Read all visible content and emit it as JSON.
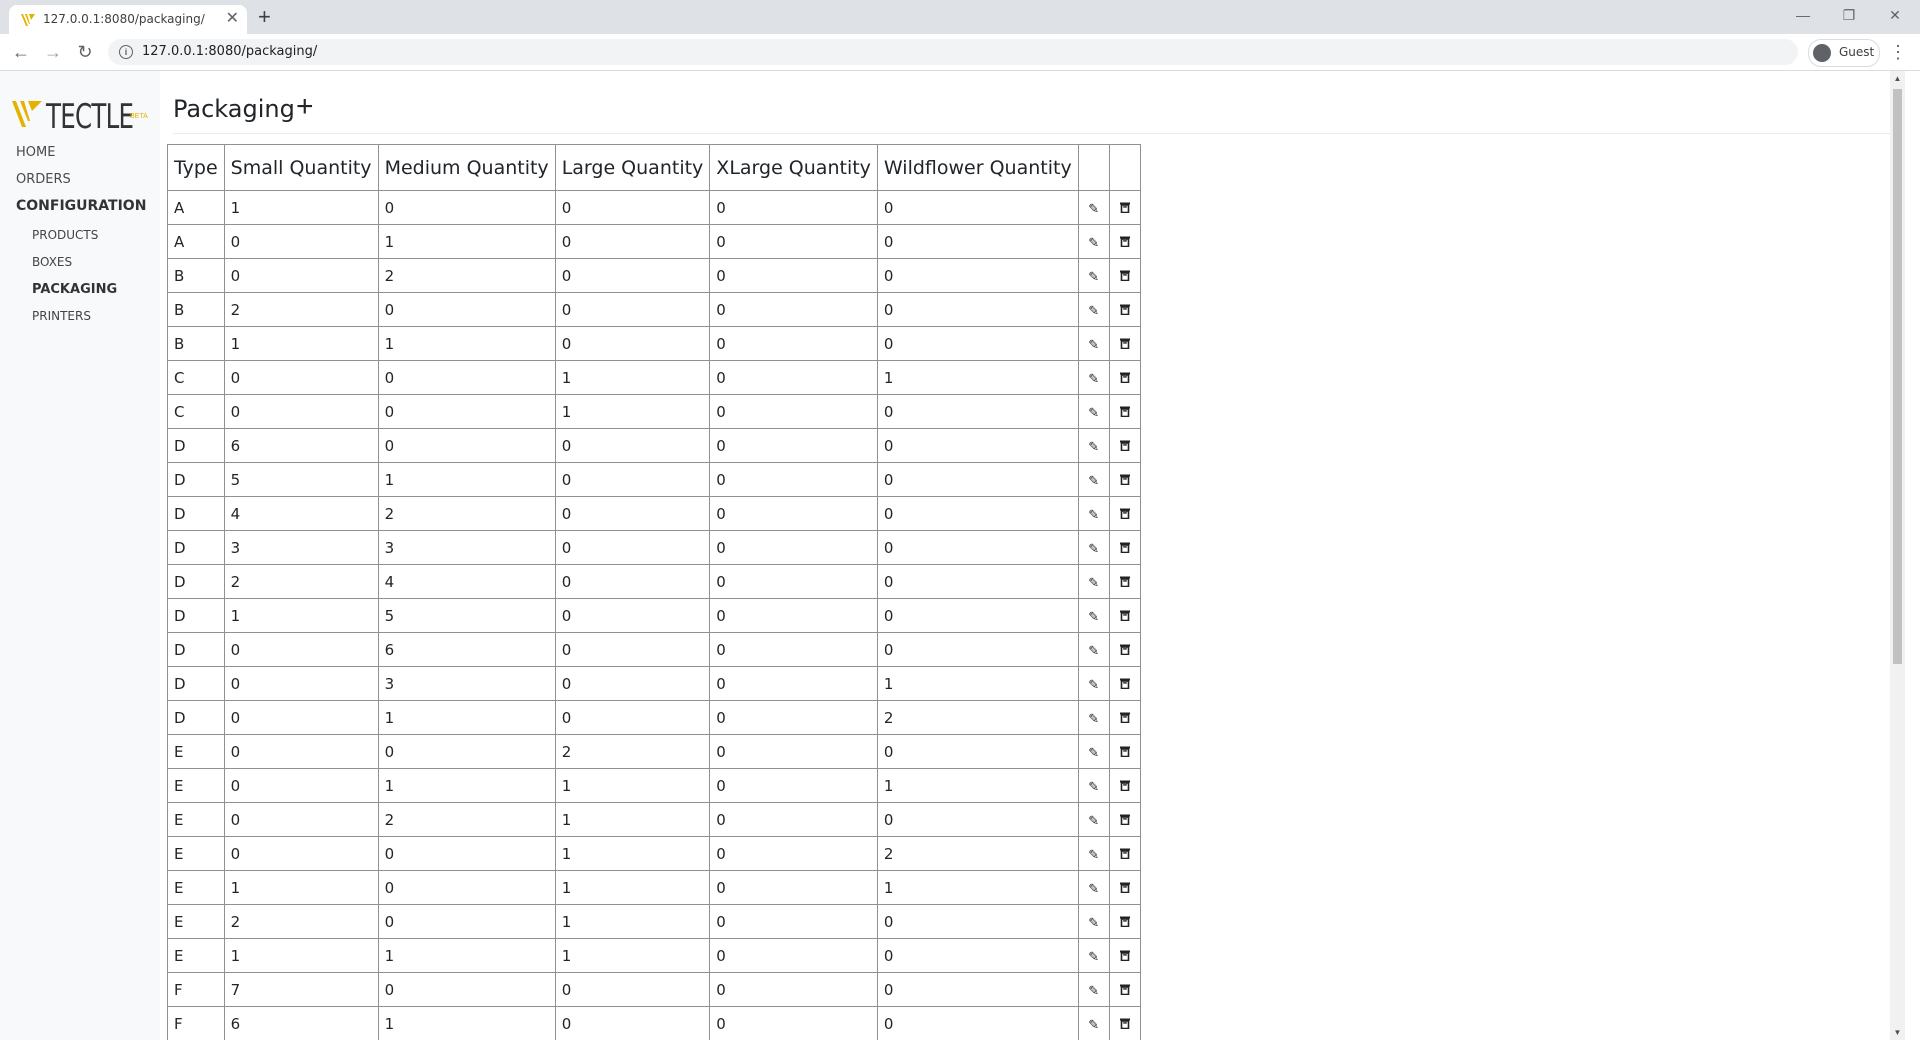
{
  "browser": {
    "tab_title": "127.0.0.1:8080/packaging/",
    "url": "127.0.0.1:8080/packaging/",
    "profile_label": "Guest"
  },
  "sidebar": {
    "logo_text": "TECTLE",
    "logo_badge": "BETA",
    "items": [
      {
        "label": "HOME"
      },
      {
        "label": "ORDERS"
      },
      {
        "label": "CONFIGURATION"
      },
      {
        "label": "PRODUCTS"
      },
      {
        "label": "BOXES"
      },
      {
        "label": "PACKAGING"
      },
      {
        "label": "PRINTERS"
      }
    ]
  },
  "page": {
    "title": "Packaging"
  },
  "table": {
    "headers": [
      "Type",
      "Small Quantity",
      "Medium Quantity",
      "Large Quantity",
      "XLarge Quantity",
      "Wildflower Quantity"
    ],
    "rows": [
      [
        "A",
        "1",
        "0",
        "0",
        "0",
        "0"
      ],
      [
        "A",
        "0",
        "1",
        "0",
        "0",
        "0"
      ],
      [
        "B",
        "0",
        "2",
        "0",
        "0",
        "0"
      ],
      [
        "B",
        "2",
        "0",
        "0",
        "0",
        "0"
      ],
      [
        "B",
        "1",
        "1",
        "0",
        "0",
        "0"
      ],
      [
        "C",
        "0",
        "0",
        "1",
        "0",
        "1"
      ],
      [
        "C",
        "0",
        "0",
        "1",
        "0",
        "0"
      ],
      [
        "D",
        "6",
        "0",
        "0",
        "0",
        "0"
      ],
      [
        "D",
        "5",
        "1",
        "0",
        "0",
        "0"
      ],
      [
        "D",
        "4",
        "2",
        "0",
        "0",
        "0"
      ],
      [
        "D",
        "3",
        "3",
        "0",
        "0",
        "0"
      ],
      [
        "D",
        "2",
        "4",
        "0",
        "0",
        "0"
      ],
      [
        "D",
        "1",
        "5",
        "0",
        "0",
        "0"
      ],
      [
        "D",
        "0",
        "6",
        "0",
        "0",
        "0"
      ],
      [
        "D",
        "0",
        "3",
        "0",
        "0",
        "1"
      ],
      [
        "D",
        "0",
        "1",
        "0",
        "0",
        "2"
      ],
      [
        "E",
        "0",
        "0",
        "2",
        "0",
        "0"
      ],
      [
        "E",
        "0",
        "1",
        "1",
        "0",
        "1"
      ],
      [
        "E",
        "0",
        "2",
        "1",
        "0",
        "0"
      ],
      [
        "E",
        "0",
        "0",
        "1",
        "0",
        "2"
      ],
      [
        "E",
        "1",
        "0",
        "1",
        "0",
        "1"
      ],
      [
        "E",
        "2",
        "0",
        "1",
        "0",
        "0"
      ],
      [
        "E",
        "1",
        "1",
        "1",
        "0",
        "0"
      ],
      [
        "F",
        "7",
        "0",
        "0",
        "0",
        "0"
      ],
      [
        "F",
        "6",
        "1",
        "0",
        "0",
        "0"
      ]
    ]
  }
}
